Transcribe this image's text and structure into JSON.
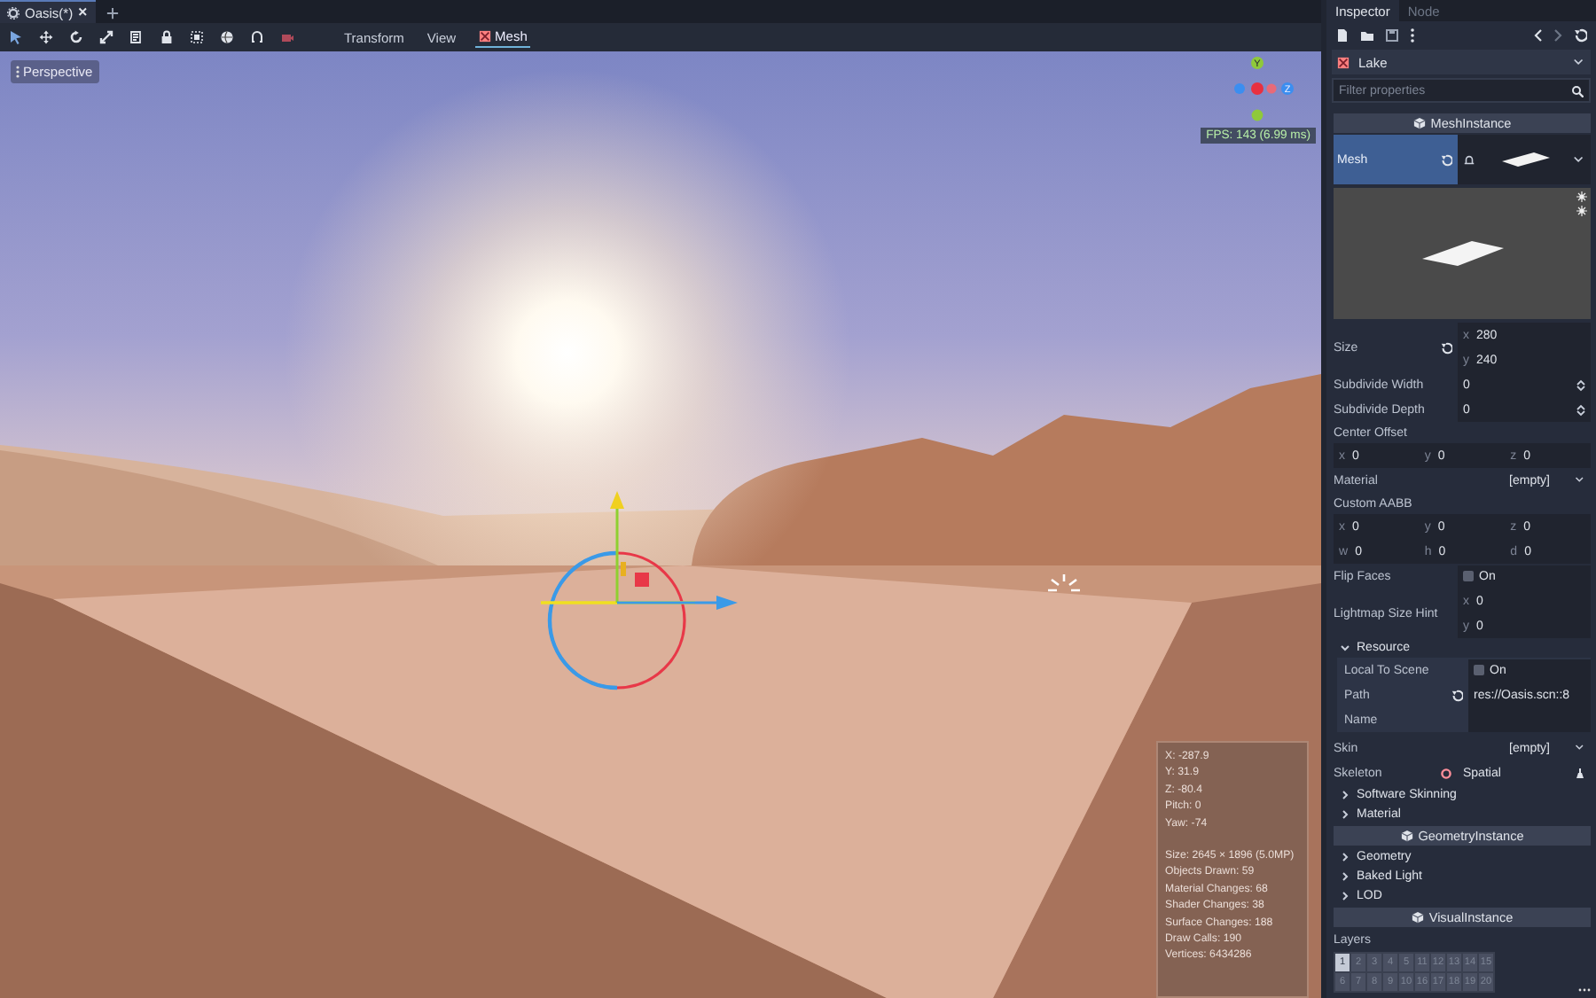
{
  "scene_tabs": [
    {
      "label": "Oasis(*)",
      "selected": true
    }
  ],
  "toolbar": {
    "menus": [
      {
        "label": "Transform",
        "selected": false
      },
      {
        "label": "View",
        "selected": false
      },
      {
        "label": "Mesh",
        "selected": true
      }
    ]
  },
  "viewport": {
    "view_menu": "Perspective",
    "axis_labels": {
      "y": "Y",
      "z": "Z"
    },
    "fps": "FPS: 143 (6.99 ms)",
    "camera_info": [
      "X: -287.9",
      "Y: 31.9",
      "Z: -80.4",
      "Pitch: 0",
      "Yaw: -74"
    ],
    "render_info": [
      "Size: 2645 × 1896 (5.0MP)",
      "Objects Drawn: 59",
      "Material Changes: 68",
      "Shader Changes: 38",
      "Surface Changes: 188",
      "Draw Calls: 190",
      "Vertices: 6434286"
    ]
  },
  "inspector": {
    "tabs": [
      {
        "label": "Inspector",
        "selected": true
      },
      {
        "label": "Node",
        "selected": false
      }
    ],
    "node": "Lake",
    "filter": {
      "placeholder": "Filter properties"
    },
    "properties": [
      {
        "kind": "section",
        "label": "MeshInstance"
      },
      {
        "kind": "resource",
        "label": "Mesh",
        "selected": true
      },
      {
        "kind": "preview"
      },
      {
        "kind": "vec_stack",
        "label": "Size",
        "revert": true,
        "fields": [
          {
            "axis": "x",
            "value": "280"
          },
          {
            "axis": "y",
            "value": "240"
          }
        ]
      },
      {
        "kind": "spin",
        "label": "Subdivide Width",
        "value": "0"
      },
      {
        "kind": "spin",
        "label": "Subdivide Depth",
        "value": "0"
      },
      {
        "kind": "group",
        "label": "Center Offset"
      },
      {
        "kind": "vec_grid",
        "fields": [
          {
            "axis": "x",
            "value": "0"
          },
          {
            "axis": "y",
            "value": "0"
          },
          {
            "axis": "z",
            "value": "0"
          }
        ]
      },
      {
        "kind": "dropdown",
        "label": "Material",
        "value": "[empty]"
      },
      {
        "kind": "group",
        "label": "Custom AABB"
      },
      {
        "kind": "vec_grid",
        "fields": [
          {
            "axis": "x",
            "value": "0"
          },
          {
            "axis": "y",
            "value": "0"
          },
          {
            "axis": "z",
            "value": "0"
          },
          {
            "axis": "w",
            "value": "0"
          },
          {
            "axis": "h",
            "value": "0"
          },
          {
            "axis": "d",
            "value": "0"
          }
        ]
      },
      {
        "kind": "check",
        "label": "Flip Faces",
        "text": "On",
        "checked": false
      },
      {
        "kind": "vec_stack",
        "label": "Lightmap Size Hint",
        "revert": false,
        "fields": [
          {
            "axis": "x",
            "value": "0"
          },
          {
            "axis": "y",
            "value": "0"
          }
        ]
      },
      {
        "kind": "category",
        "label": "Resource",
        "expanded": true,
        "children": [
          {
            "kind": "check",
            "label": "Local To Scene",
            "text": "On",
            "checked": false
          },
          {
            "kind": "path",
            "label": "Path",
            "value": "res://Oasis.scn::8"
          },
          {
            "kind": "text",
            "label": "Name"
          }
        ]
      },
      {
        "kind": "dropdown",
        "label": "Skin",
        "value": "[empty]"
      },
      {
        "kind": "node",
        "label": "Skeleton",
        "value": "Spatial"
      },
      {
        "kind": "category",
        "label": "Software Skinning",
        "expanded": false
      },
      {
        "kind": "category",
        "label": "Material",
        "expanded": false
      },
      {
        "kind": "section",
        "label": "GeometryInstance"
      },
      {
        "kind": "category",
        "label": "Geometry",
        "expanded": false
      },
      {
        "kind": "category",
        "label": "Baked Light",
        "expanded": false
      },
      {
        "kind": "category",
        "label": "LOD",
        "expanded": false
      },
      {
        "kind": "section",
        "label": "VisualInstance"
      },
      {
        "kind": "layers",
        "label": "Layers",
        "cells": [
          {
            "label": "1",
            "selected": true
          },
          {
            "label": "2",
            "selected": false
          },
          {
            "label": "3",
            "selected": false
          },
          {
            "label": "4",
            "selected": false
          },
          {
            "label": "5",
            "selected": false
          },
          {
            "label": "11",
            "selected": false
          },
          {
            "label": "12",
            "selected": false
          },
          {
            "label": "13",
            "selected": false
          },
          {
            "label": "14",
            "selected": false
          },
          {
            "label": "15",
            "selected": false
          },
          {
            "label": "6",
            "selected": false
          },
          {
            "label": "7",
            "selected": false
          },
          {
            "label": "8",
            "selected": false
          },
          {
            "label": "9",
            "selected": false
          },
          {
            "label": "10",
            "selected": false
          },
          {
            "label": "16",
            "selected": false
          },
          {
            "label": "17",
            "selected": false
          },
          {
            "label": "18",
            "selected": false
          },
          {
            "label": "19",
            "selected": false
          },
          {
            "label": "20",
            "selected": false
          }
        ]
      }
    ]
  }
}
